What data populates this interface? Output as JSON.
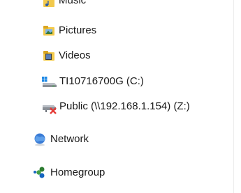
{
  "window": {
    "pane": "navigation-pane"
  },
  "navigation": {
    "items": [
      {
        "id": "music",
        "label": "Music",
        "icon": "music-folder-icon"
      },
      {
        "id": "pictures",
        "label": "Pictures",
        "icon": "pictures-folder-icon"
      },
      {
        "id": "videos",
        "label": "Videos",
        "icon": "videos-folder-icon"
      },
      {
        "id": "local-drive",
        "label": "TI10716700G (C:)",
        "icon": "local-drive-icon"
      },
      {
        "id": "network-drive",
        "label": "Public (\\\\192.168.1.154) (Z:)",
        "icon": "disconnected-network-drive-icon"
      },
      {
        "id": "network",
        "label": "Network",
        "icon": "network-icon"
      },
      {
        "id": "homegroup",
        "label": "Homegroup",
        "icon": "homegroup-icon"
      }
    ]
  },
  "colors": {
    "folder_yellow": "#f2c94c",
    "folder_dark": "#d9a520",
    "drive_gray": "#8a8f96",
    "windows_blue": "#1e88e5",
    "error_red": "#e53935",
    "network_blue": "#3a7bd5",
    "homegroup_green": "#2e7d32",
    "homegroup_blue": "#1565c0"
  }
}
